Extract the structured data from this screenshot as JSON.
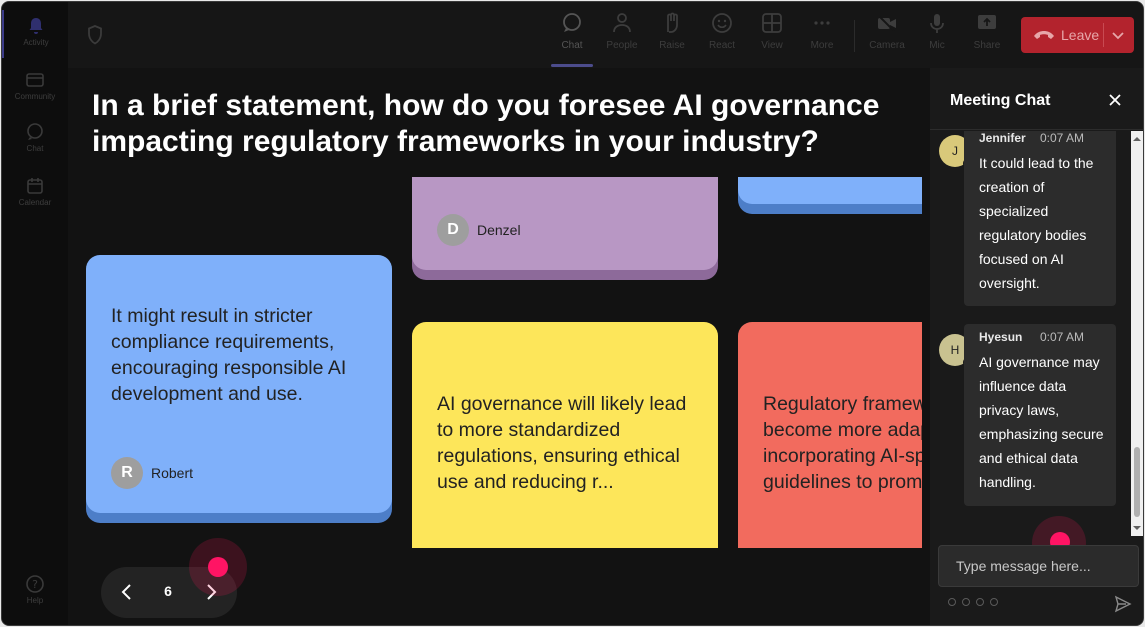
{
  "rail": {
    "items": [
      {
        "label": "Activity",
        "icon": "bell-icon",
        "active": true
      },
      {
        "label": "Community",
        "icon": "community-icon",
        "active": false
      },
      {
        "label": "Chat",
        "icon": "chat-icon",
        "active": false
      },
      {
        "label": "Calendar",
        "icon": "calendar-icon",
        "active": false
      }
    ],
    "help_label": "Help"
  },
  "toolbar": {
    "buttons": [
      {
        "label": "Chat",
        "icon": "chat-icon"
      },
      {
        "label": "People",
        "icon": "people-icon"
      },
      {
        "label": "Raise",
        "icon": "raise-hand-icon"
      },
      {
        "label": "React",
        "icon": "react-icon"
      },
      {
        "label": "View",
        "icon": "view-grid-icon"
      },
      {
        "label": "More",
        "icon": "more-icon"
      },
      {
        "label": "Camera",
        "icon": "camera-icon"
      },
      {
        "label": "Mic",
        "icon": "mic-icon"
      },
      {
        "label": "Share",
        "icon": "share-icon"
      }
    ],
    "leave_label": "Leave"
  },
  "question": "In a brief statement, how do you foresee AI governance impacting regulatory frameworks in your industry?",
  "cards": [
    {
      "text": "",
      "author": "Denzel",
      "initial": "D",
      "color": "#b897c4",
      "shadow": "#8d6a9a"
    },
    {
      "text": "",
      "author": "",
      "initial": "",
      "color": "#7fb0fa",
      "shadow": "#4d7ec8"
    },
    {
      "text": "It might result in stricter compliance requirements, encouraging responsible AI development and use.",
      "author": "Robert",
      "initial": "R",
      "color": "#7fb0fa",
      "shadow": "#4d7ec8"
    },
    {
      "text": "AI governance will likely lead to more standardized regulations, ensuring ethical use and reducing r...",
      "author": "",
      "initial": "",
      "color": "#fde65a",
      "shadow": "#c9b53a"
    },
    {
      "text": "Regulatory frameworks may become more adaptive, incorporating AI-specific guidelines to promote",
      "author": "",
      "initial": "",
      "color": "#f26b5e",
      "shadow": "#c04a3f"
    }
  ],
  "pager": {
    "page": "6"
  },
  "chat": {
    "title": "Meeting Chat",
    "messages": [
      {
        "name": "Jennifer",
        "initial": "J",
        "time": "0:07 AM",
        "avatar_color": "#d9c97a",
        "body": "It could lead to the creation of specialized regulatory bodies focused on AI oversight."
      },
      {
        "name": "Hyesun",
        "initial": "H",
        "time": "0:07 AM",
        "avatar_color": "#c9c290",
        "body": "AI governance may influence data privacy laws, emphasizing secure and ethical data handling."
      }
    ],
    "input_placeholder": "Type message here..."
  },
  "colors": {
    "accent": "#ff1464",
    "leave": "#b3232d",
    "background": "#121212"
  }
}
